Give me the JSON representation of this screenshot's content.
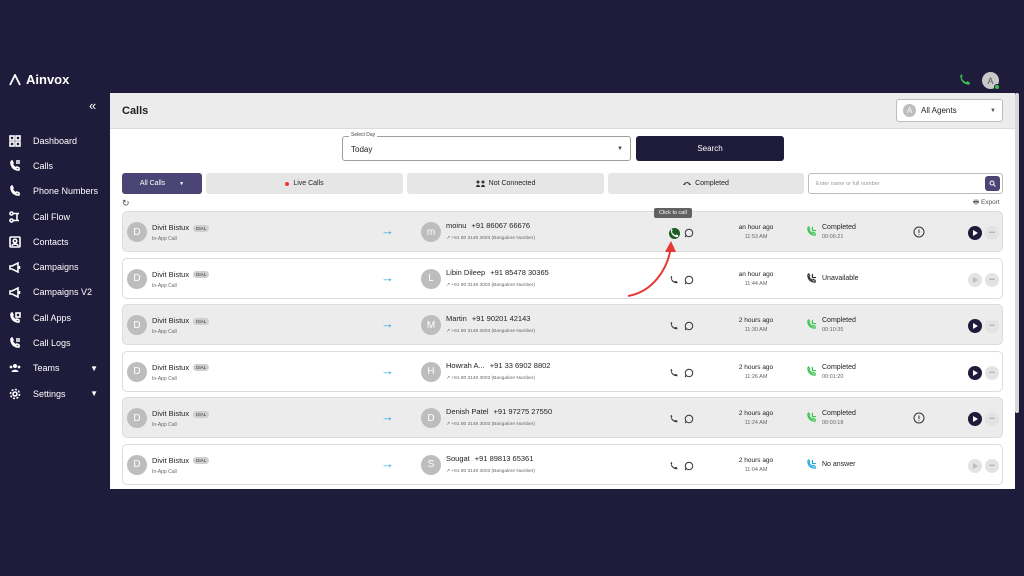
{
  "app": {
    "brand": "Ainvox"
  },
  "sidebar": {
    "items": [
      {
        "label": "Dashboard",
        "icon": "dashboard-icon"
      },
      {
        "label": "Calls",
        "icon": "calls-icon"
      },
      {
        "label": "Phone Numbers",
        "icon": "phone-icon"
      },
      {
        "label": "Call Flow",
        "icon": "flow-icon"
      },
      {
        "label": "Contacts",
        "icon": "contacts-icon"
      },
      {
        "label": "Campaigns",
        "icon": "megaphone-icon"
      },
      {
        "label": "Campaigns V2",
        "icon": "megaphone-icon"
      },
      {
        "label": "Call Apps",
        "icon": "apps-icon"
      },
      {
        "label": "Call Logs",
        "icon": "logs-icon"
      },
      {
        "label": "Teams",
        "icon": "teams-icon"
      },
      {
        "label": "Settings",
        "icon": "gear-icon"
      }
    ]
  },
  "header": {
    "title": "Calls",
    "agent_filter": "All Agents",
    "avatar_letter": "A"
  },
  "user": {
    "avatar_letter": "A"
  },
  "filters": {
    "day_label": "Select Day",
    "day_value": "Today",
    "search_button": "Search",
    "tabs": [
      "All Calls",
      "Live Calls",
      "Not Connected",
      "Completed"
    ],
    "search_placeholder": "Enter name or full number",
    "export": "Export"
  },
  "tooltip": "Click to call",
  "colors": {
    "sidebar_bg": "#1f1b3b",
    "accent": "#4a4574",
    "brand_green": "#3bc451",
    "arrow": "#2ba7e0",
    "annotation": "#e53935"
  },
  "calls": [
    {
      "caller": "Divit Bistux",
      "badge": "DIAL",
      "caller_sub": "In-App Call",
      "callee_initial": "m",
      "callee_name": "moinu",
      "callee_number": "+91 86067 66676",
      "via": "+91 80 3149 3003 (Bangalore Number)",
      "ago": "an hour ago",
      "time": "11:53 AM",
      "status": "Completed",
      "duration": "00:06:21"
    },
    {
      "caller": "Divit Bistux",
      "badge": "DIAL",
      "caller_sub": "In-App Call",
      "callee_initial": "L",
      "callee_name": "Libin Dileep",
      "callee_number": "+91 85478 30365",
      "via": "+91 80 3149 3003 (Bangalore Number)",
      "ago": "an hour ago",
      "time": "11:44 AM",
      "status": "Unavailable",
      "duration": ""
    },
    {
      "caller": "Divit Bistux",
      "badge": "DIAL",
      "caller_sub": "In-App Call",
      "callee_initial": "M",
      "callee_name": "Martin",
      "callee_number": "+91 90201 42143",
      "via": "+91 80 3149 3003 (Bangalore Number)",
      "ago": "2 hours ago",
      "time": "11:30 AM",
      "status": "Completed",
      "duration": "00:10:35"
    },
    {
      "caller": "Divit Bistux",
      "badge": "DIAL",
      "caller_sub": "In-App Call",
      "callee_initial": "H",
      "callee_name": "Howrah A...",
      "callee_number": "+91 33 6902 8802",
      "via": "+91 80 3149 3003 (Bangalore Number)",
      "ago": "2 hours ago",
      "time": "11:26 AM",
      "status": "Completed",
      "duration": "00:01:20"
    },
    {
      "caller": "Divit Bistux",
      "badge": "DIAL",
      "caller_sub": "In-App Call",
      "callee_initial": "D",
      "callee_name": "Denish Patel",
      "callee_number": "+91 97275 27550",
      "via": "+91 80 3149 3003 (Bangalore Number)",
      "ago": "2 hours ago",
      "time": "11:24 AM",
      "status": "Completed",
      "duration": "00:00:18"
    },
    {
      "caller": "Divit Bistux",
      "badge": "DIAL",
      "caller_sub": "In-App Call",
      "callee_initial": "S",
      "callee_name": "Sougat",
      "callee_number": "+91 89813 65361",
      "via": "+91 80 3149 3003 (Bangalore Number)",
      "ago": "2 hours ago",
      "time": "11:04 AM",
      "status": "No answer",
      "duration": ""
    }
  ]
}
